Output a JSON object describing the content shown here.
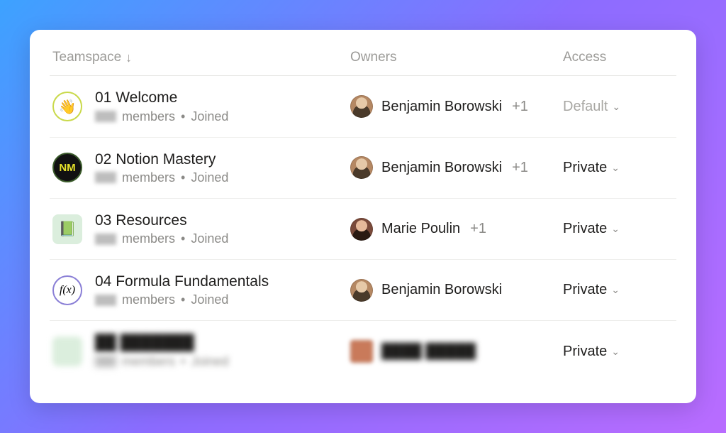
{
  "columns": {
    "teamspace": "Teamspace",
    "owners": "Owners",
    "access": "Access"
  },
  "sort": {
    "column": "teamspace",
    "direction": "asc"
  },
  "labels": {
    "members_word": "members",
    "joined": "Joined",
    "separator": "•"
  },
  "rows": [
    {
      "icon_type": "wave",
      "icon_glyph": "👋",
      "title": "01 Welcome",
      "members_hidden": true,
      "joined": true,
      "owner_avatar": "b",
      "owner_name": "Benjamin Borowski",
      "owner_plus": "+1",
      "access": "Default",
      "access_muted": true
    },
    {
      "icon_type": "nm",
      "icon_glyph": "NM",
      "title": "02 Notion Mastery",
      "members_hidden": true,
      "joined": true,
      "owner_avatar": "b",
      "owner_name": "Benjamin Borowski",
      "owner_plus": "+1",
      "access": "Private",
      "access_muted": false
    },
    {
      "icon_type": "res",
      "icon_glyph": "📗",
      "title": "03 Resources",
      "members_hidden": true,
      "joined": true,
      "owner_avatar": "m",
      "owner_name": "Marie Poulin",
      "owner_plus": "+1",
      "access": "Private",
      "access_muted": false
    },
    {
      "icon_type": "fx",
      "icon_glyph": "f(x)",
      "title": "04 Formula Fundamentals",
      "members_hidden": true,
      "joined": true,
      "owner_avatar": "b",
      "owner_name": "Benjamin Borowski",
      "owner_plus": "",
      "access": "Private",
      "access_muted": false
    },
    {
      "icon_type": "blur",
      "icon_glyph": "",
      "title": "██ ███████",
      "members_hidden": true,
      "joined": true,
      "owner_avatar": "sq",
      "owner_name": "████ █████",
      "owner_plus": "",
      "access": "Private",
      "access_muted": false,
      "fully_blurred": true
    }
  ]
}
